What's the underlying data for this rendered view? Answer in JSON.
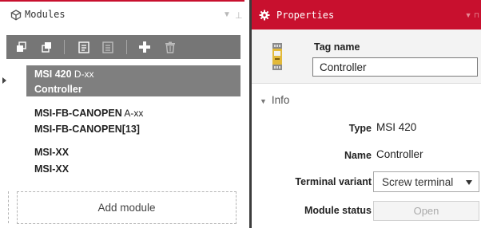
{
  "modules_panel": {
    "title": "Modules",
    "icons": {
      "header": "modules-icon",
      "dropdown": "chevron-down-icon",
      "pin": "pin-icon"
    },
    "toolbar": [
      {
        "name": "expand-all-icon"
      },
      {
        "name": "collapse-all-icon"
      },
      {
        "name": "module-properties-icon"
      },
      {
        "name": "module-list-icon"
      },
      {
        "name": "add-icon"
      },
      {
        "name": "delete-icon"
      }
    ],
    "modules": [
      {
        "model": "MSI 420",
        "suffix": " D-xx",
        "tag": "Controller",
        "selected": true
      },
      {
        "model": "MSI-FB-CANOPEN",
        "suffix": " A-xx",
        "tag": "MSI-FB-CANOPEN[13]",
        "selected": false
      },
      {
        "model": "MSI-XX",
        "suffix": "",
        "tag": "MSI-XX",
        "selected": false
      }
    ],
    "add_module_label": "Add module"
  },
  "properties_panel": {
    "title": "Properties",
    "icons": {
      "header": "gear-icon",
      "device": "controller-device-icon",
      "section": "chevron-down-icon"
    },
    "tag_name_label": "Tag name",
    "tag_name_value": "Controller",
    "section_title": "Info",
    "type_label": "Type",
    "type_value": "MSI 420",
    "name_label": "Name",
    "name_value": "Controller",
    "terminal_variant_label": "Terminal variant",
    "terminal_variant_value": "Screw terminal",
    "module_status_label": "Module status",
    "open_button_label": "Open"
  },
  "colors": {
    "accent": "#c8102e",
    "selection": "#7f7f7f",
    "toolbar": "#767676"
  }
}
